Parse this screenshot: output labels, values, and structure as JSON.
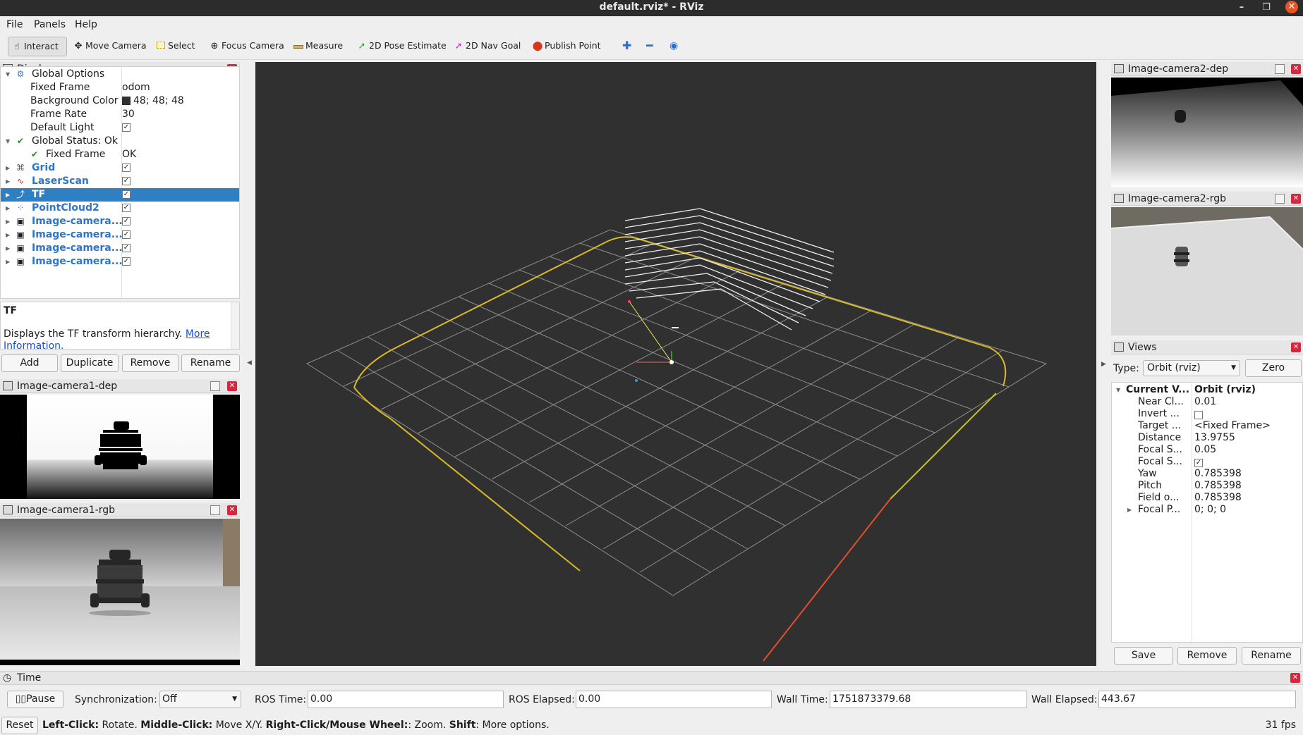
{
  "window": {
    "title": "default.rviz* - RViz"
  },
  "menu": [
    "File",
    "Panels",
    "Help"
  ],
  "toolbar": {
    "interact": "Interact",
    "move_camera": "Move Camera",
    "select": "Select",
    "focus_camera": "Focus Camera",
    "measure": "Measure",
    "pose_estimate": "2D Pose Estimate",
    "nav_goal": "2D Nav Goal",
    "publish_point": "Publish Point"
  },
  "displays": {
    "title": "Displays",
    "global_options": "Global Options",
    "fixed_frame_label": "Fixed Frame",
    "fixed_frame_value": "odom",
    "bg_color_label": "Background Color",
    "bg_color_value": "48; 48; 48",
    "frame_rate_label": "Frame Rate",
    "frame_rate_value": "30",
    "default_light_label": "Default Light",
    "global_status": "Global Status: Ok",
    "status_fixed_frame": "Fixed Frame",
    "status_fixed_frame_value": "OK",
    "items": [
      "Grid",
      "LaserScan",
      "TF",
      "PointCloud2",
      "Image-camera...",
      "Image-camera...",
      "Image-camera...",
      "Image-camera..."
    ],
    "selected": "TF"
  },
  "description": {
    "heading": "TF",
    "text": "Displays the TF transform hierarchy.",
    "link": "More Information."
  },
  "display_buttons": {
    "add": "Add",
    "duplicate": "Duplicate",
    "remove": "Remove",
    "rename": "Rename"
  },
  "image_panels": {
    "cam1_dep": "Image-camera1-dep",
    "cam1_rgb": "Image-camera1-rgb",
    "cam2_dep": "Image-camera2-dep",
    "cam2_rgb": "Image-camera2-rgb"
  },
  "views": {
    "title": "Views",
    "type_label": "Type:",
    "type_value": "Orbit (rviz)",
    "zero": "Zero",
    "current_label": "Current V...",
    "current_value": "Orbit (rviz)",
    "props": [
      {
        "k": "Near Cl...",
        "v": "0.01"
      },
      {
        "k": "Invert ...",
        "v": ""
      },
      {
        "k": "Target ...",
        "v": "<Fixed Frame>"
      },
      {
        "k": "Distance",
        "v": "13.9755"
      },
      {
        "k": "Focal S...",
        "v": "0.05"
      },
      {
        "k": "Focal S...",
        "v": ""
      },
      {
        "k": "Yaw",
        "v": "0.785398"
      },
      {
        "k": "Pitch",
        "v": "0.785398"
      },
      {
        "k": "Field o...",
        "v": "0.785398"
      },
      {
        "k": "Focal P...",
        "v": "0; 0; 0"
      }
    ],
    "save": "Save",
    "remove": "Remove",
    "rename": "Rename"
  },
  "time": {
    "title": "Time",
    "pause": "Pause",
    "sync_label": "Synchronization:",
    "sync_value": "Off",
    "ros_time_label": "ROS Time:",
    "ros_time": "0.00",
    "ros_elapsed_label": "ROS Elapsed:",
    "ros_elapsed": "0.00",
    "wall_time_label": "Wall Time:",
    "wall_time": "1751873379.68",
    "wall_elapsed_label": "Wall Elapsed:",
    "wall_elapsed": "443.67"
  },
  "status": {
    "reset": "Reset",
    "b1": "Left-Click:",
    "t1": " Rotate. ",
    "b2": "Middle-Click:",
    "t2": " Move X/Y. ",
    "b3": "Right-Click/Mouse Wheel:",
    "t3": ": Zoom. ",
    "b4": "Shift",
    "t4": ": More options.",
    "fps": "31 fps"
  }
}
